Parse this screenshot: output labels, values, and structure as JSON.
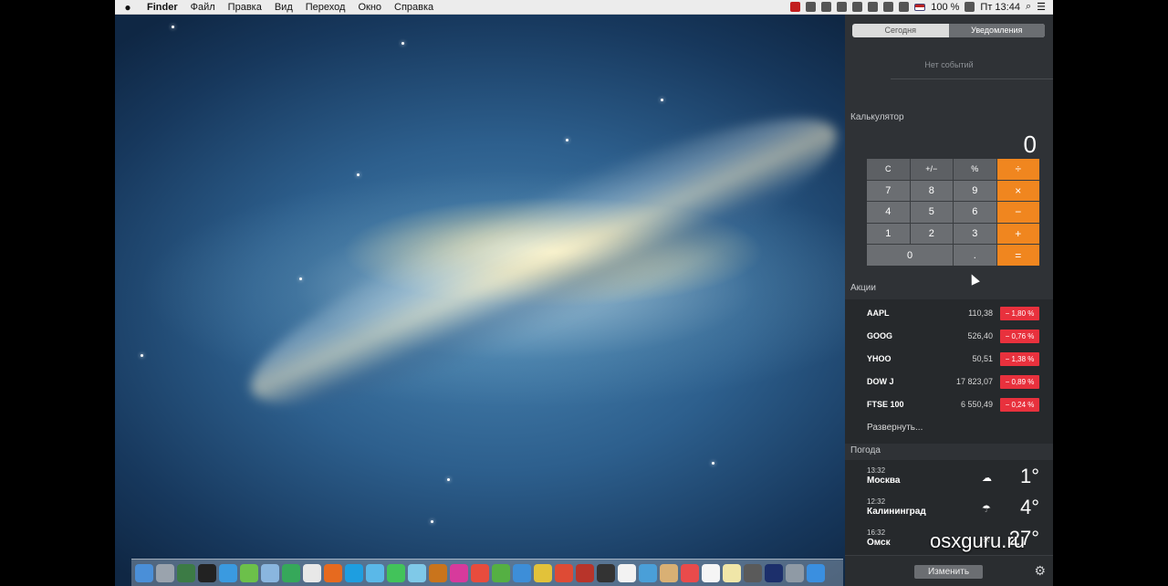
{
  "menubar": {
    "app": "Finder",
    "menus": [
      "Файл",
      "Правка",
      "Вид",
      "Переход",
      "Окно",
      "Справка"
    ],
    "battery": "100 %",
    "clock": "Пт 13:44"
  },
  "notification_center": {
    "tabs": [
      "Сегодня",
      "Уведомления"
    ],
    "no_events": "Нет событий",
    "calculator": {
      "title": "Калькулятор",
      "display": "0",
      "keys": [
        "C",
        "+/−",
        "%",
        "÷",
        "7",
        "8",
        "9",
        "×",
        "4",
        "5",
        "6",
        "−",
        "1",
        "2",
        "3",
        "+",
        "0",
        ".",
        "="
      ]
    },
    "stocks": {
      "title": "Акции",
      "rows": [
        {
          "symbol": "AAPL",
          "price": "110,38",
          "change": "− 1,80 %"
        },
        {
          "symbol": "GOOG",
          "price": "526,40",
          "change": "− 0,76 %"
        },
        {
          "symbol": "YHOO",
          "price": "50,51",
          "change": "− 1,38 %"
        },
        {
          "symbol": "DOW J",
          "price": "17 823,07",
          "change": "− 0,89 %"
        },
        {
          "symbol": "FTSE 100",
          "price": "6 550,49",
          "change": "− 0,24 %"
        }
      ],
      "expand": "Развернуть..."
    },
    "weather": {
      "title": "Погода",
      "rows": [
        {
          "time": "13:32",
          "city": "Москва",
          "temp": "1°",
          "icon": "cloud-icon"
        },
        {
          "time": "12:32",
          "city": "Калининград",
          "temp": "4°",
          "icon": "rain-cloud-icon"
        },
        {
          "time": "16:32",
          "city": "Омск",
          "temp": "27°",
          "icon": "sun-icon"
        }
      ]
    },
    "edit_button": "Изменить"
  },
  "watermark": "osxguru.ru",
  "colors": {
    "operator_key": "#f0861f",
    "stock_down": "#e8313d",
    "panel": "#2f3236"
  }
}
